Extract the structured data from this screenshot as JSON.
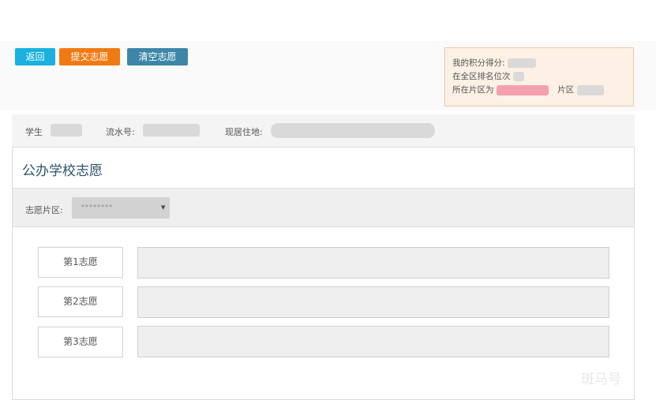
{
  "toolbar": {
    "back_label": "返回",
    "submit_label": "提交志愿",
    "clear_label": "清空志愿",
    "colors": {
      "back": "#1ab0e0",
      "submit": "#f07a12",
      "clear": "#3d86a8"
    }
  },
  "score_box": {
    "score_label": "我的积分得分:",
    "rank_label": "在全区排名位次",
    "district_label": "所在片区为",
    "district_suffix": "片区"
  },
  "student": {
    "name_label": "学生",
    "serial_label": "流水号:",
    "address_label": "现居住地:"
  },
  "section": {
    "title": "公办学校志愿",
    "district_select_label": "志愿片区:",
    "district_select_value": "********"
  },
  "choices": [
    {
      "label": "第1志愿",
      "value": ""
    },
    {
      "label": "第2志愿",
      "value": ""
    },
    {
      "label": "第3志愿",
      "value": ""
    }
  ],
  "watermark": "斑马号"
}
